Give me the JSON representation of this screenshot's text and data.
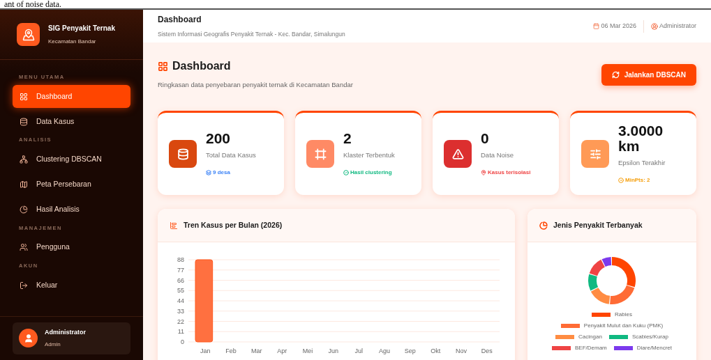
{
  "document_text": "ant of noise data.",
  "sidebar": {
    "app_title": "SIG Penyakit Ternak",
    "app_subtitle": "Kecamatan Bandar",
    "sections": [
      {
        "heading": "MENU UTAMA",
        "items": [
          {
            "label": "Dashboard",
            "selected": true
          },
          {
            "label": "Data Kasus",
            "selected": false
          }
        ]
      },
      {
        "heading": "ANALISIS",
        "items": [
          {
            "label": "Clustering DBSCAN",
            "selected": false
          },
          {
            "label": "Peta Persebaran",
            "selected": false
          },
          {
            "label": "Hasil Analisis",
            "selected": false
          }
        ]
      },
      {
        "heading": "MANAJEMEN",
        "items": [
          {
            "label": "Pengguna",
            "selected": false
          }
        ]
      },
      {
        "heading": "AKUN",
        "items": [
          {
            "label": "Keluar",
            "selected": false
          }
        ]
      }
    ],
    "user": {
      "name": "Administrator",
      "role": "Admin"
    }
  },
  "topbar": {
    "title": "Dashboard",
    "subtitle": "Sistem Informasi Geografis Penyakit Ternak - Kec. Bandar, Simalungun",
    "date": "06 Mar 2026",
    "user": "Administrator"
  },
  "page": {
    "title": "Dashboard",
    "subtitle": "Ringkasan data penyebaran penyakit ternak di Kecamatan Bandar",
    "action": "Jalankan DBSCAN"
  },
  "stats": [
    {
      "kind": "database",
      "value": "200",
      "label": "Total Data Kasus",
      "note": "9 desa",
      "color": "#3b82f6"
    },
    {
      "kind": "cluster",
      "value": "2",
      "label": "Klaster Terbentuk",
      "note": "Hasil clustering",
      "color": "#10b981"
    },
    {
      "kind": "noise",
      "value": "0",
      "label": "Data Noise",
      "note": "Kasus terisolasi",
      "color": "#ef4444"
    },
    {
      "kind": "epsilon",
      "value": "3.0000 km",
      "label": "Epsilon Terakhir",
      "note": "MinPts: 2",
      "color": "#f59e0b"
    }
  ],
  "trend": {
    "title": "Tren Kasus per Bulan (2026)",
    "chart_data": {
      "type": "bar",
      "categories": [
        "Jan",
        "Feb",
        "Mar",
        "Apr",
        "Mei",
        "Jun",
        "Jul",
        "Agu",
        "Sep",
        "Okt",
        "Nov",
        "Des"
      ],
      "values": [
        88,
        0,
        0,
        0,
        0,
        0,
        0,
        0,
        0,
        0,
        0,
        0
      ],
      "ylim": [
        0,
        88
      ],
      "grid": true,
      "yticks": [
        0,
        11,
        22,
        33,
        44,
        55,
        66,
        77,
        88
      ]
    }
  },
  "diseases": {
    "title": "Jenis Penyakit Terbanyak",
    "legend": [
      {
        "label": "Rabies",
        "color": "#ff4500"
      },
      {
        "label": "Penyakit Mulut dan Kuku (PMK)",
        "color": "#ff6b35"
      },
      {
        "label": "Cacingan",
        "color": "#ff8c42"
      },
      {
        "label": "Scabies/Kurap",
        "color": "#10b981"
      },
      {
        "label": "BEF/Demam",
        "color": "#ef4444"
      },
      {
        "label": "Diare/Mencret",
        "color": "#7c3aed"
      }
    ]
  }
}
